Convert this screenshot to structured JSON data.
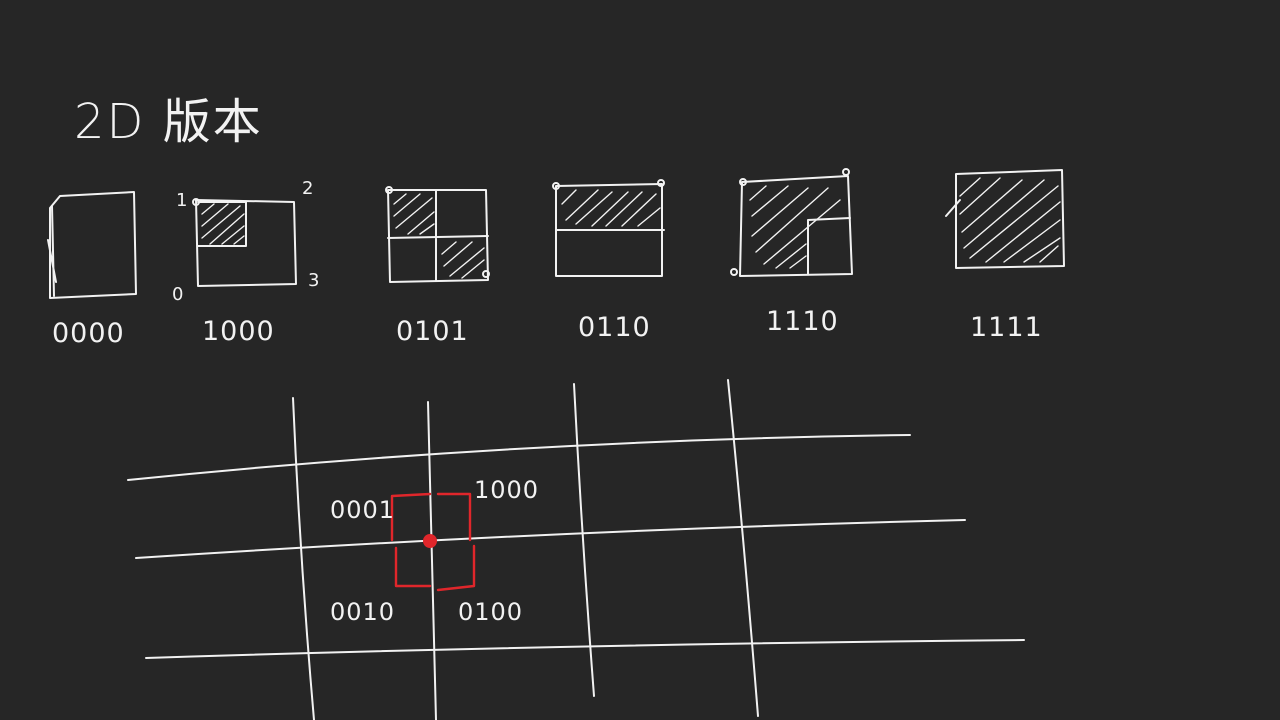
{
  "title": "2D 版本",
  "cases": [
    {
      "code": "0000"
    },
    {
      "code": "1000",
      "corner_labels": [
        "1",
        "2",
        "0",
        "3"
      ]
    },
    {
      "code": "0101"
    },
    {
      "code": "0110"
    },
    {
      "code": "1110"
    },
    {
      "code": "1111"
    }
  ],
  "grid": {
    "cell_labels": [
      "0001",
      "1000",
      "0010",
      "0100"
    ]
  },
  "colors": {
    "background": "#262626",
    "ink": "#f2f2f2",
    "highlight": "#e0262b"
  }
}
